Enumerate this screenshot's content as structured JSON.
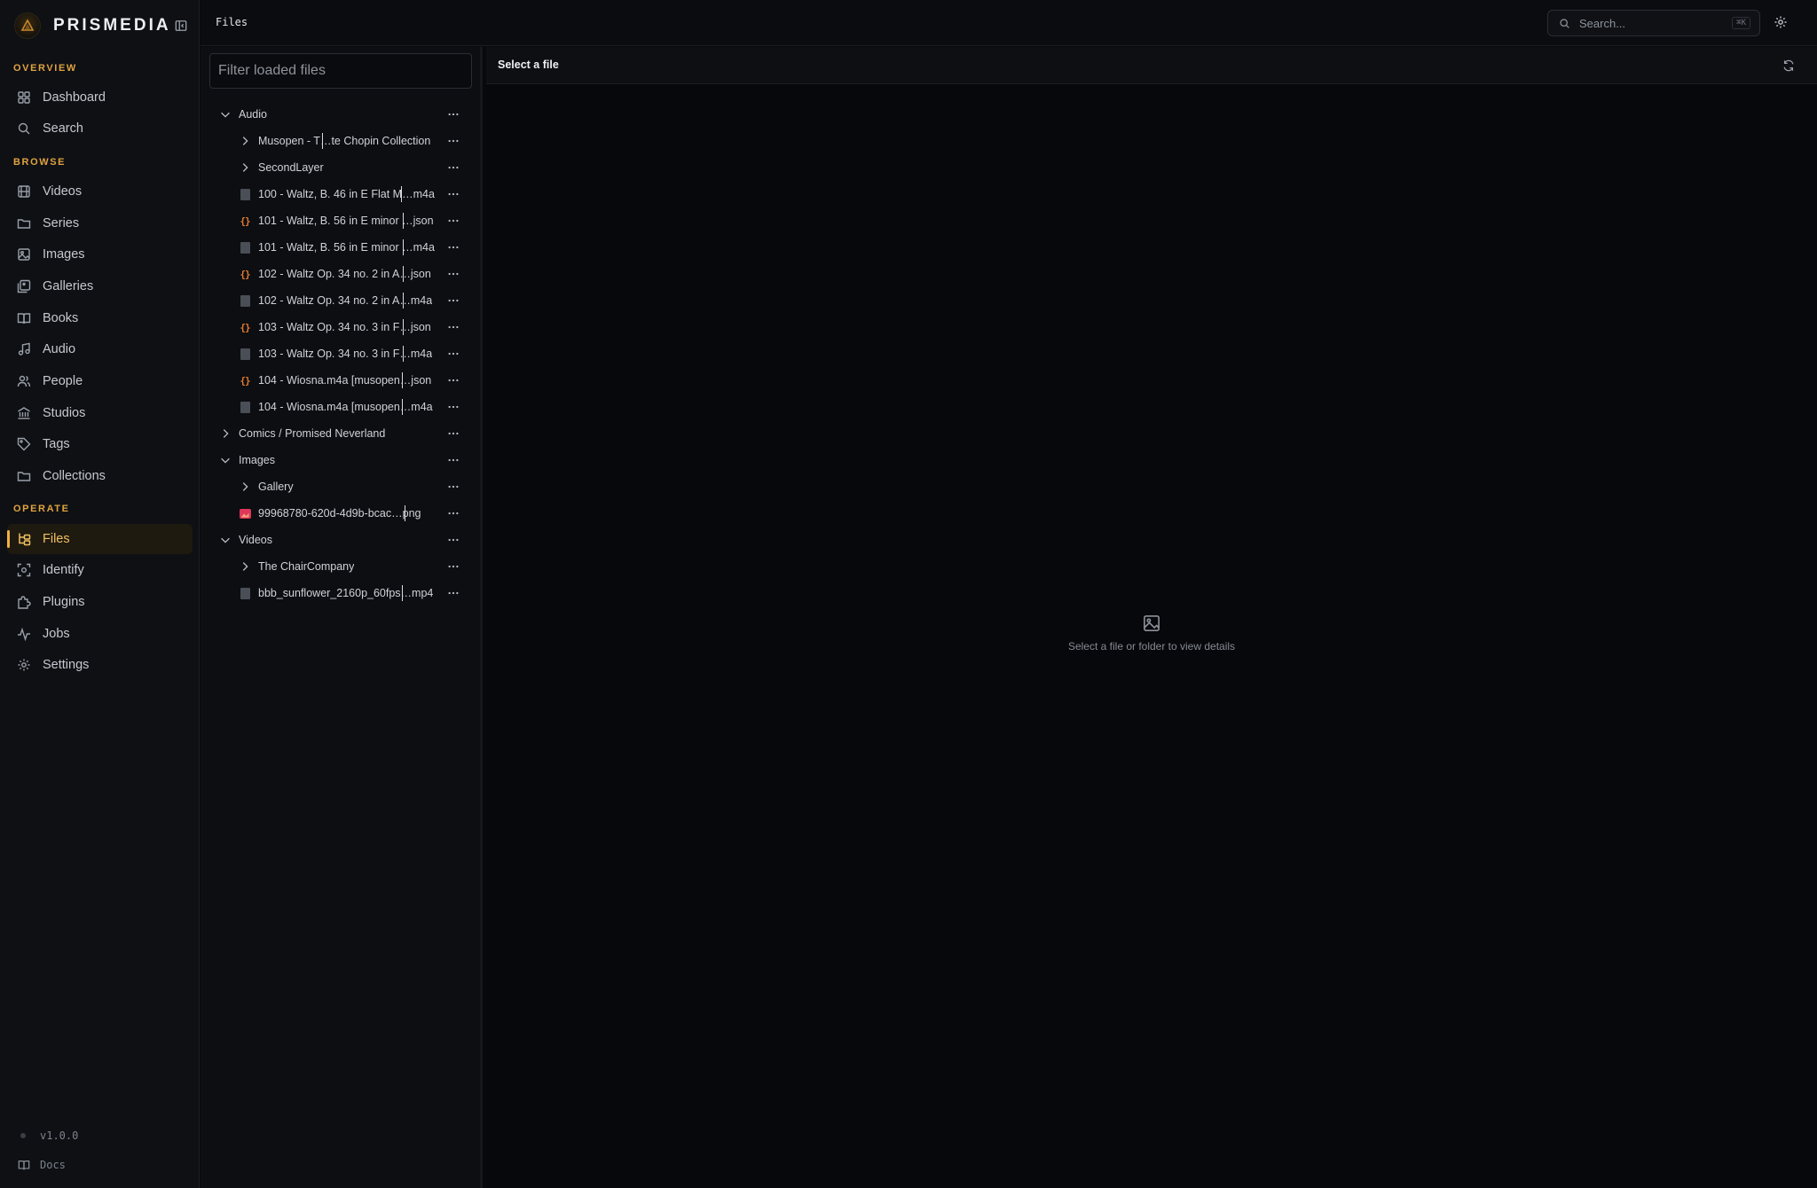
{
  "app": {
    "name": "PRISMEDIA",
    "version": "v1.0.0",
    "docs_label": "Docs"
  },
  "nav": {
    "sections": [
      {
        "label": "OVERVIEW",
        "items": [
          {
            "label": "Dashboard",
            "icon": "grid-icon"
          },
          {
            "label": "Search",
            "icon": "search-icon"
          }
        ]
      },
      {
        "label": "BROWSE",
        "items": [
          {
            "label": "Videos",
            "icon": "film-icon"
          },
          {
            "label": "Series",
            "icon": "folder-icon"
          },
          {
            "label": "Images",
            "icon": "image-icon"
          },
          {
            "label": "Galleries",
            "icon": "galleries-icon"
          },
          {
            "label": "Books",
            "icon": "book-icon"
          },
          {
            "label": "Audio",
            "icon": "music-icon"
          },
          {
            "label": "People",
            "icon": "users-icon"
          },
          {
            "label": "Studios",
            "icon": "studio-icon"
          },
          {
            "label": "Tags",
            "icon": "tag-icon"
          },
          {
            "label": "Collections",
            "icon": "folder-icon"
          }
        ]
      },
      {
        "label": "OPERATE",
        "items": [
          {
            "label": "Files",
            "icon": "folder-tree-icon",
            "active": true
          },
          {
            "label": "Identify",
            "icon": "scan-icon"
          },
          {
            "label": "Plugins",
            "icon": "puzzle-icon"
          },
          {
            "label": "Jobs",
            "icon": "activity-icon"
          },
          {
            "label": "Settings",
            "icon": "gear-icon"
          }
        ]
      }
    ]
  },
  "topbar": {
    "breadcrumb": "Files",
    "search_placeholder": "Search...",
    "search_shortcut": "⌘K"
  },
  "tree": {
    "filter_placeholder": "Filter loaded files",
    "items": [
      {
        "label": "Audio",
        "kind": "folder",
        "expanded": true,
        "depth": 0
      },
      {
        "label": "Musopen - T…te Chopin Collection",
        "kind": "folder",
        "expanded": false,
        "depth": 1
      },
      {
        "label": "SecondLayer",
        "kind": "folder",
        "expanded": false,
        "depth": 1
      },
      {
        "label": "100 - Waltz, B. 46 in E Flat M…m4a",
        "kind": "file",
        "depth": 1
      },
      {
        "label": "101 - Waltz, B. 56 in E minor …json",
        "kind": "json",
        "depth": 1
      },
      {
        "label": "101 - Waltz, B. 56 in E minor …m4a",
        "kind": "file",
        "depth": 1
      },
      {
        "label": "102 - Waltz Op. 34 no. 2 in A…json",
        "kind": "json",
        "depth": 1
      },
      {
        "label": "102 - Waltz Op. 34 no. 2 in A…m4a",
        "kind": "file",
        "depth": 1
      },
      {
        "label": "103 - Waltz Op. 34 no. 3 in F…json",
        "kind": "json",
        "depth": 1
      },
      {
        "label": "103 - Waltz Op. 34 no. 3 in F…m4a",
        "kind": "file",
        "depth": 1
      },
      {
        "label": "104 - Wiosna.m4a [musopen…json",
        "kind": "json",
        "depth": 1
      },
      {
        "label": "104 - Wiosna.m4a [musopen…m4a",
        "kind": "file",
        "depth": 1
      },
      {
        "label": "Comics / Promised Neverland",
        "kind": "folder",
        "expanded": false,
        "depth": 0
      },
      {
        "label": "Images",
        "kind": "folder",
        "expanded": true,
        "depth": 0
      },
      {
        "label": "Gallery",
        "kind": "folder",
        "expanded": false,
        "depth": 1
      },
      {
        "label": "99968780-620d-4d9b-bcac…png",
        "kind": "image",
        "depth": 1
      },
      {
        "label": "Videos",
        "kind": "folder",
        "expanded": true,
        "depth": 0
      },
      {
        "label": "The ChairCompany",
        "kind": "folder",
        "expanded": false,
        "depth": 1
      },
      {
        "label": "bbb_sunflower_2160p_60fps…mp4",
        "kind": "file",
        "depth": 1
      }
    ]
  },
  "detail": {
    "title": "Select a file",
    "empty_message": "Select a file or folder to view details"
  },
  "colors": {
    "accent": "#f0b040",
    "json_icon": "#e07a2e",
    "image_icon": "#e0365a"
  }
}
